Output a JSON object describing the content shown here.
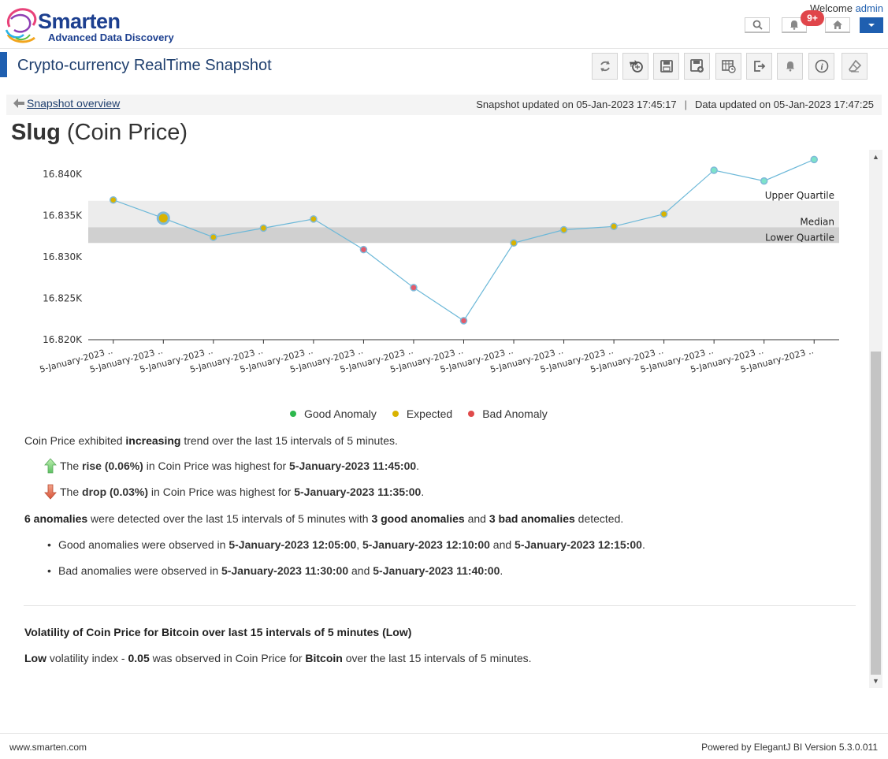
{
  "header": {
    "logo_name": "Smarten",
    "logo_tagline": "Advanced Data Discovery",
    "welcome_text": "Welcome",
    "username": "admin",
    "notification_badge": "9+",
    "icons": [
      "search-icon",
      "bell-icon",
      "home-icon",
      "chevron-down-icon"
    ]
  },
  "page": {
    "title": "Crypto-currency RealTime Snapshot",
    "toolbar_icons": [
      "refresh-icon",
      "share-icon",
      "save-icon",
      "save-as-icon",
      "schedule-icon",
      "export-icon",
      "alert-icon",
      "info-icon",
      "clear-icon"
    ]
  },
  "subbar": {
    "back_label": "Snapshot overview",
    "snapshot_updated": "Snapshot updated on 05-Jan-2023 17:45:17",
    "separator": "|",
    "data_updated": "Data updated on 05-Jan-2023 17:47:25"
  },
  "heading": {
    "bold": "Slug",
    "rest": "(Coin Price)"
  },
  "chart_data": {
    "type": "line",
    "x": [
      "5-January-2023 ..",
      "5-January-2023 ..",
      "5-January-2023 ..",
      "5-January-2023 ..",
      "5-January-2023 ..",
      "5-January-2023 ..",
      "5-January-2023 ..",
      "5-January-2023 ..",
      "5-January-2023 ..",
      "5-January-2023 ..",
      "5-January-2023 ..",
      "5-January-2023 ..",
      "5-January-2023 ..",
      "5-January-2023 ..",
      "5-January-2023 .."
    ],
    "values": [
      16836.9,
      16834.7,
      16832.4,
      16833.5,
      16834.6,
      16830.9,
      16826.3,
      16822.3,
      16831.7,
      16833.3,
      16833.7,
      16835.2,
      16840.5,
      16839.2,
      16841.8
    ],
    "point_status": [
      "Expected",
      "Expected",
      "Expected",
      "Expected",
      "Expected",
      "Bad Anomaly",
      "Bad Anomaly",
      "Bad Anomaly",
      "Expected",
      "Expected",
      "Expected",
      "Expected",
      "Good Anomaly",
      "Good Anomaly",
      "Good Anomaly"
    ],
    "highlighted_index": 1,
    "y_ticks": [
      16820,
      16825,
      16830,
      16835,
      16840
    ],
    "y_tick_labels": [
      "16.820K",
      "16.825K",
      "16.830K",
      "16.835K",
      "16.840K"
    ],
    "ylim": [
      16820,
      16842.5
    ],
    "bands": {
      "upper_quartile": 16836.8,
      "median": 16833.6,
      "lower_quartile": 16831.7
    },
    "band_labels": {
      "upper": "Upper Quartile",
      "median": "Median",
      "lower": "Lower Quartile"
    },
    "legend": [
      "Good Anomaly",
      "Expected",
      "Bad Anomaly"
    ],
    "colors": {
      "line": "#6cb8d8",
      "good": "#2db84d",
      "expected": "#d9b300",
      "bad": "#e04a4a",
      "good_fill": "#7ee3c9",
      "expected_fill": "#d9b300",
      "bad_fill": "#e35a6a",
      "marker_outline": "#7fb9d9",
      "upper_band": "#ececec",
      "lower_band": "#d0d0d0"
    }
  },
  "insights": {
    "trend_prefix": "Coin Price exhibited ",
    "trend_word": "increasing",
    "trend_suffix": " trend over the last 15 intervals of 5 minutes.",
    "rise_the": "The ",
    "rise_bold": "rise (0.06%)",
    "rise_mid": " in Coin Price was highest for ",
    "rise_time": "5-January-2023 11:45:00",
    "rise_end": ".",
    "drop_the": "The ",
    "drop_bold": "drop (0.03%)",
    "drop_mid": " in Coin Price was highest for ",
    "drop_time": "5-January-2023 11:35:00",
    "drop_end": ".",
    "anom_count": "6 anomalies",
    "anom_mid": " were detected over the last 15 intervals of 5 minutes with ",
    "anom_good": "3 good anomalies",
    "anom_and": " and ",
    "anom_bad": "3 bad anomalies",
    "anom_end": " detected.",
    "good_prefix": "Good anomalies were observed in ",
    "good_t1": "5-January-2023 12:05:00",
    "good_comma": ", ",
    "good_t2": "5-January-2023 12:10:00",
    "good_and": " and ",
    "good_t3": "5-January-2023 12:15:00",
    "good_end": ".",
    "bad_prefix": "Bad anomalies were observed in ",
    "bad_t1": "5-January-2023 11:30:00",
    "bad_and": " and ",
    "bad_t2": "5-January-2023 11:40:00",
    "bad_end": "."
  },
  "volatility": {
    "heading": "Volatility of Coin Price for Bitcoin over last 15 intervals of 5 minutes (Low)",
    "level": "Low",
    "mid1": " volatility index - ",
    "index": "0.05",
    "mid2": " was observed in Coin Price for ",
    "coin": "Bitcoin",
    "end": " over the last 15 intervals of 5 minutes."
  },
  "footer": {
    "left": "www.smarten.com",
    "right": "Powered by ElegantJ BI Version 5.3.0.011"
  }
}
